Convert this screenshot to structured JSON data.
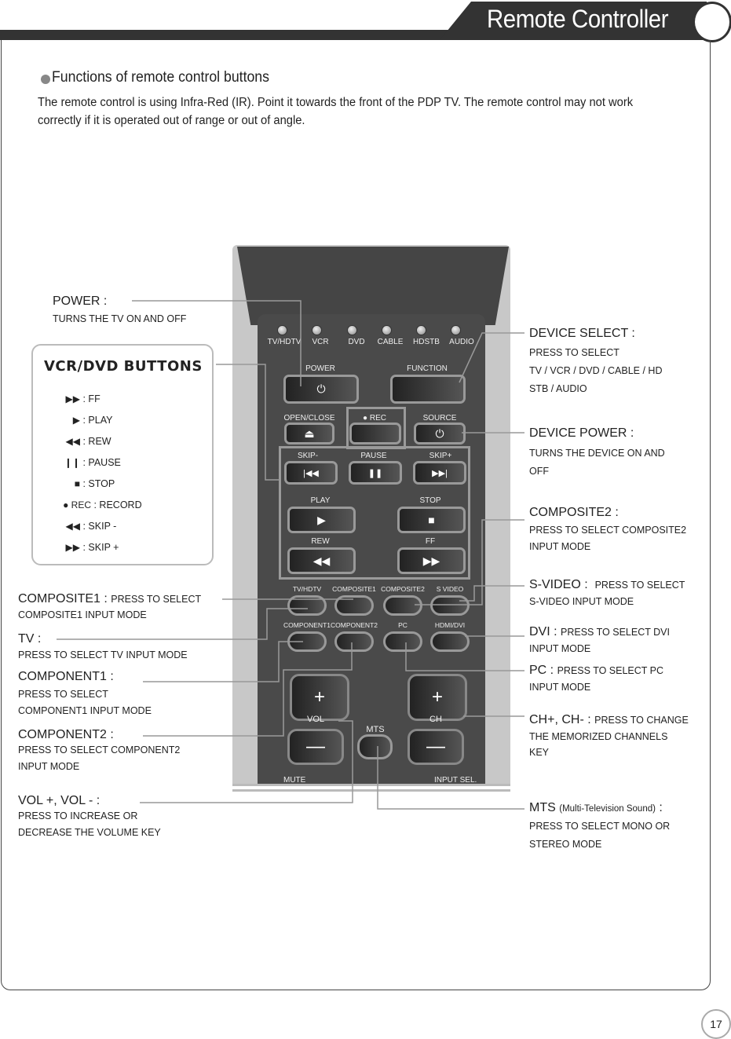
{
  "header": {
    "title": "Remote Controller"
  },
  "section": {
    "title": "Functions of remote control buttons",
    "intro": "The remote control is using Infra-Red (IR). Point it towards the front of the PDP TV. The remote control may not work correctly if it is operated out of range or out of angle."
  },
  "remote": {
    "device_leds": [
      "TV/HDTV",
      "VCR",
      "DVD",
      "CABLE",
      "HDSTB",
      "AUDIO"
    ],
    "power_label": "POWER",
    "function_label": "FUNCTION",
    "open_close_label": "OPEN/CLOSE",
    "rec_label": "● REC",
    "source_label": "SOURCE",
    "skip_minus_label": "SKIP-",
    "pause_label": "PAUSE",
    "skip_plus_label": "SKIP+",
    "play_label": "PLAY",
    "stop_label": "STOP",
    "rew_label": "REW",
    "ff_label": "FF",
    "input_row1": [
      "TV/HDTV",
      "COMPOSITE1",
      "COMPOSITE2",
      "S VIDEO"
    ],
    "input_row2": [
      "COMPONENT1",
      "COMPONENT2",
      "PC",
      "HDMI/DVI"
    ],
    "vol_label": "VOL",
    "ch_label": "CH",
    "mts_label": "MTS",
    "mute_label": "MUTE",
    "input_sel_label": "INPUT SEL.",
    "icons": {
      "power": "⏻",
      "eject": "⏏",
      "skip_prev": "|◀◀",
      "pause": "❚❚",
      "skip_next": "▶▶|",
      "play": "▶",
      "stop": "■",
      "rew": "◀◀",
      "ff": "▶▶",
      "plus": "+",
      "minus": "—"
    }
  },
  "vcr_buttons": {
    "title": "VCR/DVD BUTTONS",
    "items": [
      {
        "symbol": "▶▶",
        "label": ": FF"
      },
      {
        "symbol": "▶",
        "label": ": PLAY"
      },
      {
        "symbol": "◀◀",
        "label": ": REW"
      },
      {
        "symbol": "❙❙",
        "label": ": PAUSE"
      },
      {
        "symbol": "■",
        "label": ": STOP"
      },
      {
        "symbol": "● REC",
        "label": ": RECORD"
      },
      {
        "symbol": "◀◀",
        "label": ": SKIP -"
      },
      {
        "symbol": "▶▶",
        "label": ": SKIP +"
      }
    ]
  },
  "left_annotations": {
    "power": {
      "head": "POWER :",
      "lines": [
        "TURNS THE TV ON AND OFF"
      ]
    },
    "composite1": {
      "head": "COMPOSITE1 :",
      "inline": "PRESS TO SELECT",
      "lines": [
        "COMPOSITE1 INPUT MODE"
      ]
    },
    "tv": {
      "head": "TV :",
      "lines": [
        "PRESS TO SELECT TV INPUT MODE"
      ]
    },
    "component1": {
      "head": "COMPONENT1 :",
      "lines": [
        "PRESS TO SELECT",
        "COMPONENT1 INPUT MODE"
      ]
    },
    "component2": {
      "head": "COMPONENT2 :",
      "lines": [
        "PRESS TO SELECT COMPONENT2",
        "INPUT MODE"
      ]
    },
    "vol": {
      "head": "VOL +, VOL - :",
      "lines": [
        "PRESS TO INCREASE OR",
        "DECREASE THE VOLUME KEY"
      ]
    }
  },
  "right_annotations": {
    "device_select": {
      "head": "DEVICE SELECT :",
      "lines": [
        "PRESS TO SELECT",
        "TV / VCR / DVD / CABLE / HD",
        "STB / AUDIO"
      ]
    },
    "device_power": {
      "head": "DEVICE POWER :",
      "lines": [
        "TURNS THE DEVICE ON AND",
        "OFF"
      ]
    },
    "composite2": {
      "head": "COMPOSITE2 :",
      "lines": [
        "PRESS TO SELECT COMPOSITE2",
        "INPUT MODE"
      ]
    },
    "svideo": {
      "head": "S-VIDEO :",
      "inline": "PRESS TO SELECT",
      "lines": [
        "S-VIDEO INPUT MODE"
      ]
    },
    "dvi": {
      "head": "DVI :",
      "inline": "PRESS TO SELECT DVI",
      "lines": [
        "INPUT MODE"
      ]
    },
    "pc": {
      "head": "PC :",
      "inline": "PRESS TO SELECT PC",
      "lines": [
        "INPUT MODE"
      ]
    },
    "ch": {
      "head": "CH+, CH- :",
      "inline": "PRESS TO CHANGE",
      "lines": [
        "THE MEMORIZED CHANNELS",
        "KEY"
      ]
    },
    "mts": {
      "head": "MTS",
      "paren": "(Multi-Television Sound)",
      "colon": " :",
      "lines": [
        "PRESS TO SELECT MONO OR",
        "STEREO MODE"
      ]
    }
  },
  "page_number": "17"
}
